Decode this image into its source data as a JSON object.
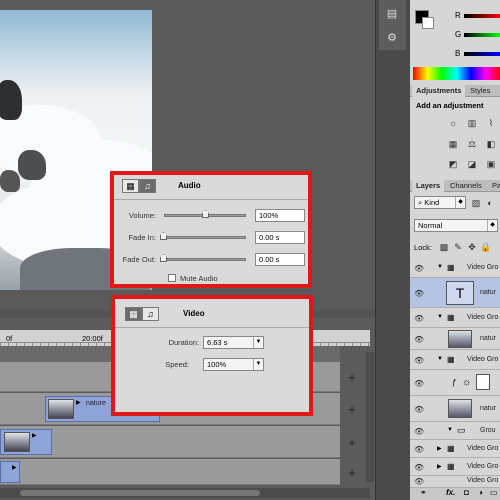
{
  "audio_dialog": {
    "title": "Audio",
    "volume_label": "Volume:",
    "volume_value": "100%",
    "volume_level": 0.5,
    "fade_in_label": "Fade In:",
    "fade_in_value": "0.00 s",
    "fade_out_label": "Fade Out:",
    "fade_out_value": "0.00 s",
    "mute_label": "Mute Audio"
  },
  "video_dialog": {
    "title": "Video",
    "duration_label": "Duration:",
    "duration_value": "6.63 s",
    "speed_label": "Speed:",
    "speed_value": "100%"
  },
  "timeline": {
    "ruler_labels": [
      "0f",
      "20:00f"
    ],
    "clip_label": "nature"
  },
  "color_panel": {
    "labels": [
      "R",
      "G",
      "B"
    ]
  },
  "adjustments_panel": {
    "tabs": [
      "Adjustments",
      "Styles"
    ],
    "heading": "Add an adjustment"
  },
  "layers_panel": {
    "tabs": [
      "Layers",
      "Channels",
      "Pa"
    ],
    "kind_label": "Kind",
    "blend_mode": "Normal",
    "lock_label": "Lock:",
    "layers": [
      {
        "name": "Video Gro"
      },
      {
        "name": "natur"
      },
      {
        "name": "Video Gro"
      },
      {
        "name": "natur"
      },
      {
        "name": "Video Gro"
      },
      {
        "name": "natur"
      },
      {
        "name": "Grou"
      },
      {
        "name": "Video Gro"
      },
      {
        "name": "Video Gro"
      },
      {
        "name": "Video Gro"
      }
    ]
  },
  "colors": {
    "highlight": "#e01818",
    "clip": "#8ea4d8"
  }
}
